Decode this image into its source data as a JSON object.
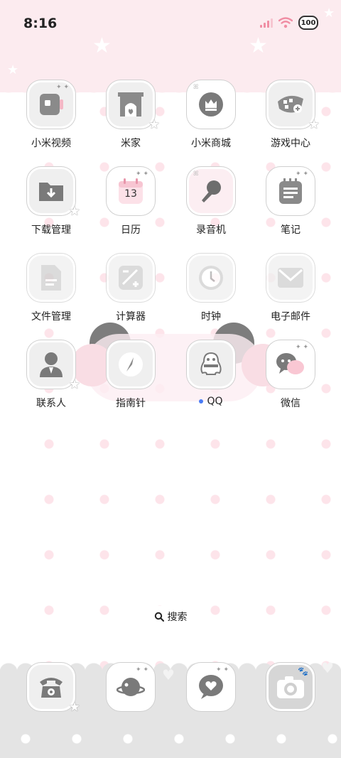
{
  "status_bar": {
    "time": "8:16",
    "battery": "100",
    "signal_color": "#f08ea4"
  },
  "apps": [
    {
      "id": "mi-video",
      "label": "小米视频",
      "icon": "video-icon",
      "style": "gray",
      "badge": "sparkle"
    },
    {
      "id": "mijia",
      "label": "米家",
      "icon": "fireplace-icon",
      "style": "gray",
      "badge": "star"
    },
    {
      "id": "mi-store",
      "label": "小米商城",
      "icon": "crown-bag-icon",
      "style": "white",
      "badge": "bow"
    },
    {
      "id": "game-center",
      "label": "游戏中心",
      "icon": "gamepad-icon",
      "style": "gray",
      "badge": "star"
    },
    {
      "id": "downloads",
      "label": "下载管理",
      "icon": "download-folder-icon",
      "style": "gray",
      "badge": "star"
    },
    {
      "id": "calendar",
      "label": "日历",
      "icon": "calendar-icon",
      "style": "white",
      "badge": "sparkle",
      "calendar_day": "13"
    },
    {
      "id": "recorder",
      "label": "录音机",
      "icon": "microphone-icon",
      "style": "pink",
      "badge": "bow"
    },
    {
      "id": "notes",
      "label": "笔记",
      "icon": "notepad-icon",
      "style": "white",
      "badge": "sparkle"
    },
    {
      "id": "file-manager",
      "label": "文件管理",
      "icon": "file-icon",
      "style": "dim",
      "badge": ""
    },
    {
      "id": "calculator",
      "label": "计算器",
      "icon": "calculator-icon",
      "style": "dim",
      "badge": ""
    },
    {
      "id": "clock",
      "label": "时钟",
      "icon": "clock-icon",
      "style": "dim",
      "badge": ""
    },
    {
      "id": "email",
      "label": "电子邮件",
      "icon": "envelope-icon",
      "style": "dim",
      "badge": ""
    },
    {
      "id": "contacts",
      "label": "联系人",
      "icon": "person-icon",
      "style": "gray",
      "badge": "star"
    },
    {
      "id": "compass",
      "label": "指南针",
      "icon": "compass-icon",
      "style": "gray",
      "badge": ""
    },
    {
      "id": "qq",
      "label": "QQ",
      "icon": "penguin-icon",
      "style": "gray",
      "badge": "",
      "notification_dot": true
    },
    {
      "id": "wechat",
      "label": "微信",
      "icon": "chat-bubbles-icon",
      "style": "white",
      "badge": "sparkle"
    }
  ],
  "search": {
    "label": "搜索"
  },
  "dock": [
    {
      "id": "phone",
      "icon": "telephone-icon",
      "badge": "star"
    },
    {
      "id": "browser",
      "icon": "planet-icon",
      "badge": "sparkle"
    },
    {
      "id": "messages",
      "icon": "heart-message-icon",
      "badge": "sparkle"
    },
    {
      "id": "camera",
      "icon": "camera-icon",
      "badge": "paw"
    }
  ],
  "theme": {
    "accent_pink": "#fcebef",
    "dot_pink": "#fde4ea",
    "icon_gray": "#8a8a8a",
    "dock_gray": "#e4e4e4",
    "qq_dot": "#4a7cf5"
  }
}
